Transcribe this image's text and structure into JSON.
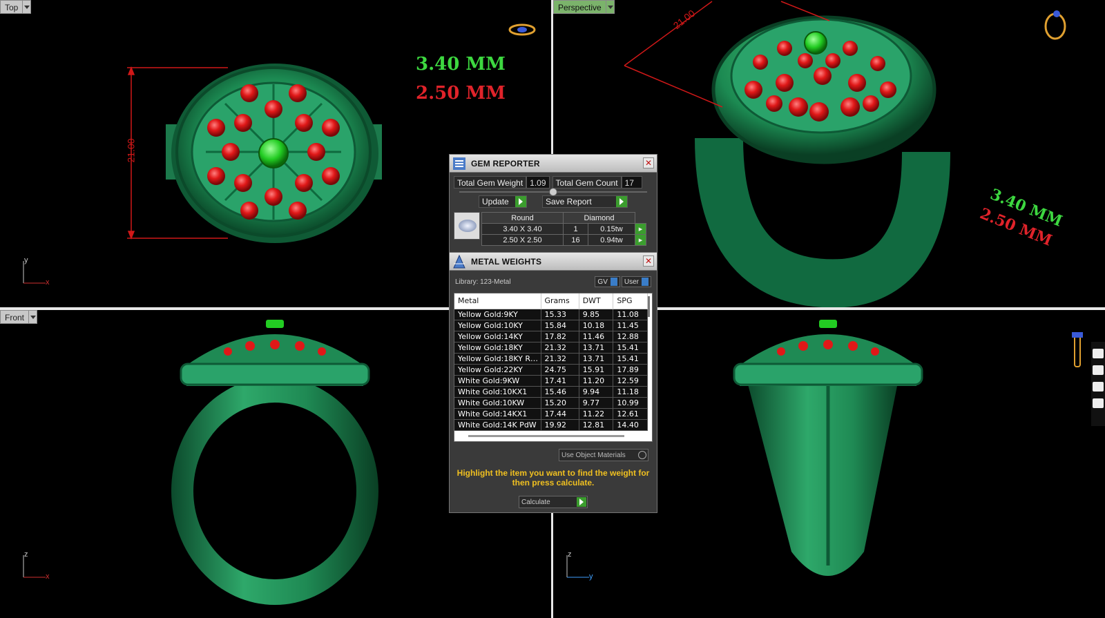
{
  "viewports": {
    "top": {
      "label": "Top",
      "dimension": "21.00",
      "mm_large": "3.40 MM",
      "mm_small": "2.50 MM",
      "axis": [
        "y",
        "x"
      ]
    },
    "perspective": {
      "label": "Perspective",
      "dimension": "21.00",
      "mm_large": "3.40 MM",
      "mm_small": "2.50 MM"
    },
    "front": {
      "label": "Front",
      "axis": [
        "z",
        "x"
      ]
    },
    "right": {
      "axis": [
        "z",
        "y"
      ]
    }
  },
  "gem_reporter": {
    "title": "GEM REPORTER",
    "total_weight_label": "Total Gem Weight",
    "total_weight_value": "1.09",
    "total_count_label": "Total Gem Count",
    "total_count_value": "17",
    "update_label": "Update",
    "save_label": "Save Report",
    "table_header": [
      "Round",
      "Diamond"
    ],
    "rows": [
      {
        "size": "3.40 X 3.40",
        "count": "1",
        "weight": "0.15tw"
      },
      {
        "size": "2.50 X 2.50",
        "count": "16",
        "weight": "0.94tw"
      }
    ]
  },
  "metal_weights": {
    "title": "METAL WEIGHTS",
    "library": "Library: 123-Metal",
    "gv_label": "GV",
    "user_label": "User",
    "columns": [
      "Metal",
      "Grams",
      "DWT",
      "SPG"
    ],
    "rows": [
      [
        "Yellow Gold:9KY",
        "15.33",
        "9.85",
        "11.08"
      ],
      [
        "Yellow Gold:10KY",
        "15.84",
        "10.18",
        "11.45"
      ],
      [
        "Yellow Gold:14KY",
        "17.82",
        "11.46",
        "12.88"
      ],
      [
        "Yellow Gold:18KY",
        "21.32",
        "13.71",
        "15.41"
      ],
      [
        "Yellow Gold:18KY R…",
        "21.32",
        "13.71",
        "15.41"
      ],
      [
        "Yellow Gold:22KY",
        "24.75",
        "15.91",
        "17.89"
      ],
      [
        "White Gold:9KW",
        "17.41",
        "11.20",
        "12.59"
      ],
      [
        "White Gold:10KX1",
        "15.46",
        "9.94",
        "11.18"
      ],
      [
        "White Gold:10KW",
        "15.20",
        "9.77",
        "10.99"
      ],
      [
        "White Gold:14KX1",
        "17.44",
        "11.22",
        "12.61"
      ],
      [
        "White Gold:14K PdW",
        "19.92",
        "12.81",
        "14.40"
      ]
    ],
    "use_object_materials": "Use Object Materials",
    "hint": "Highlight the item you want to find the weight for then press calculate.",
    "calculate_label": "Calculate"
  },
  "colors": {
    "ring_green": "#1f8a5a",
    "ruby_red": "#e01818",
    "center_green": "#22cc22",
    "dim_red": "#d01818"
  }
}
